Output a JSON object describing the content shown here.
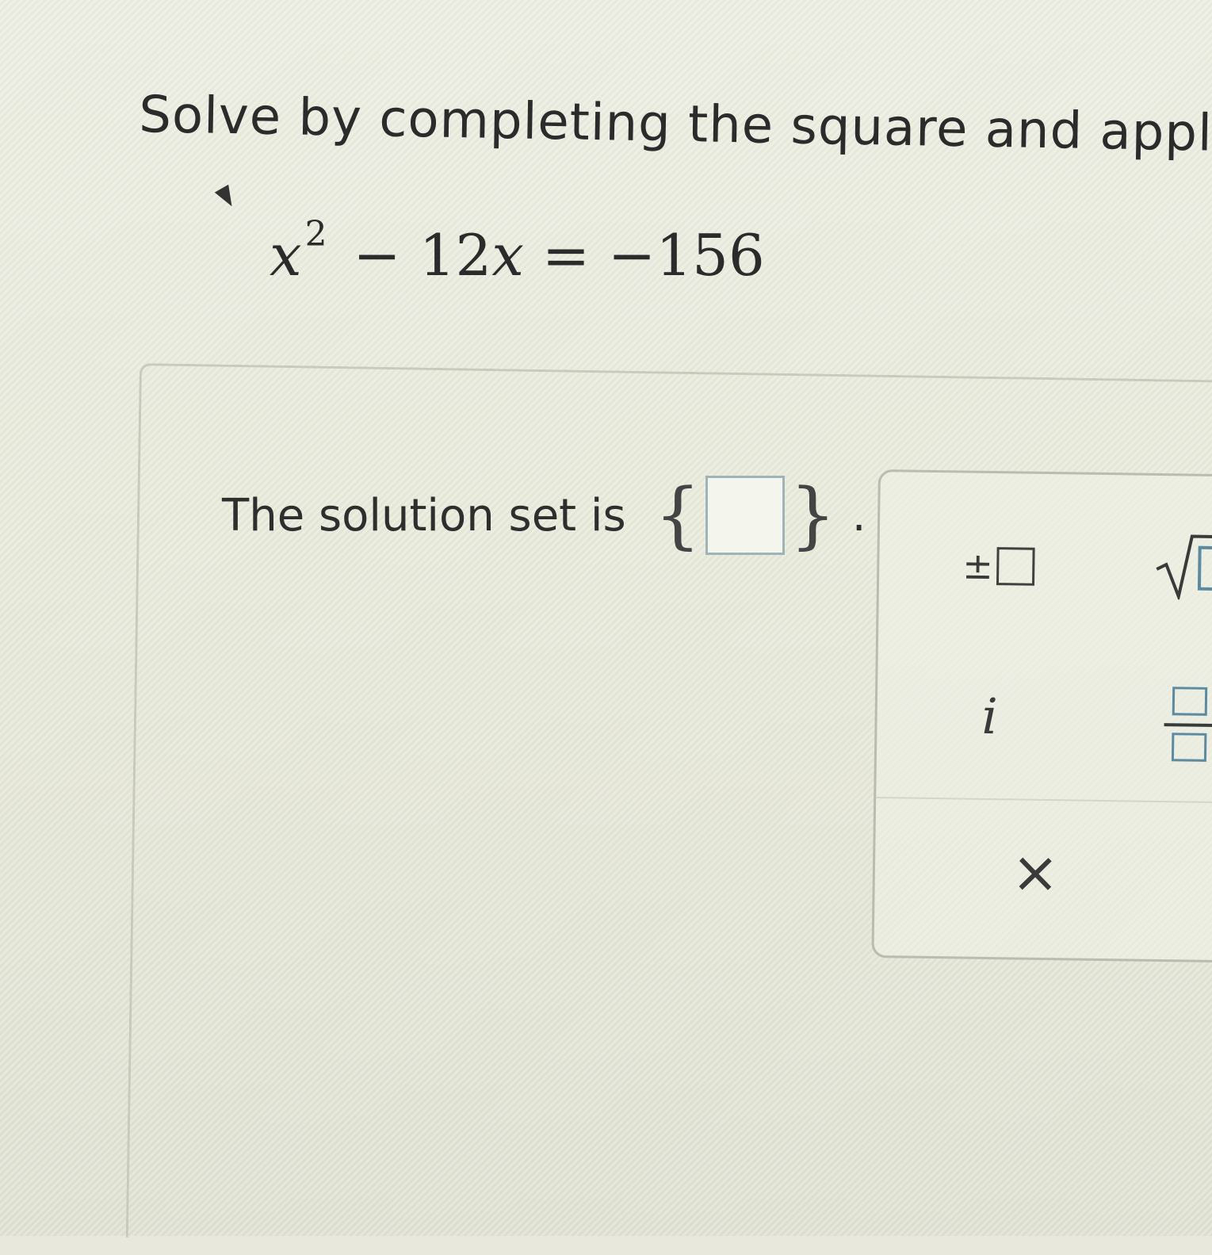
{
  "question": {
    "instruction": "Solve by completing the square and applying"
  },
  "equation": {
    "variable": "x",
    "exponent": "2",
    "middle": " − 12",
    "middle_var": "x",
    "rhs": " = −156"
  },
  "answer": {
    "prefix": "The solution set is",
    "open_brace": "{",
    "close_brace": "}",
    "suffix": ".",
    "value": ""
  },
  "palette": {
    "plus_minus_symbol": "±",
    "imaginary_symbol": "i",
    "clear_symbol": "×"
  },
  "colors": {
    "background": "#e8e9dc",
    "input_border": "#9fb3b8",
    "fraction_box": "#5c8aa0"
  },
  "icons": {
    "plus_minus": "plus-minus-box-icon",
    "sqrt": "square-root-icon",
    "imaginary": "imaginary-unit-icon",
    "fraction": "fraction-icon",
    "clear": "close-icon"
  }
}
